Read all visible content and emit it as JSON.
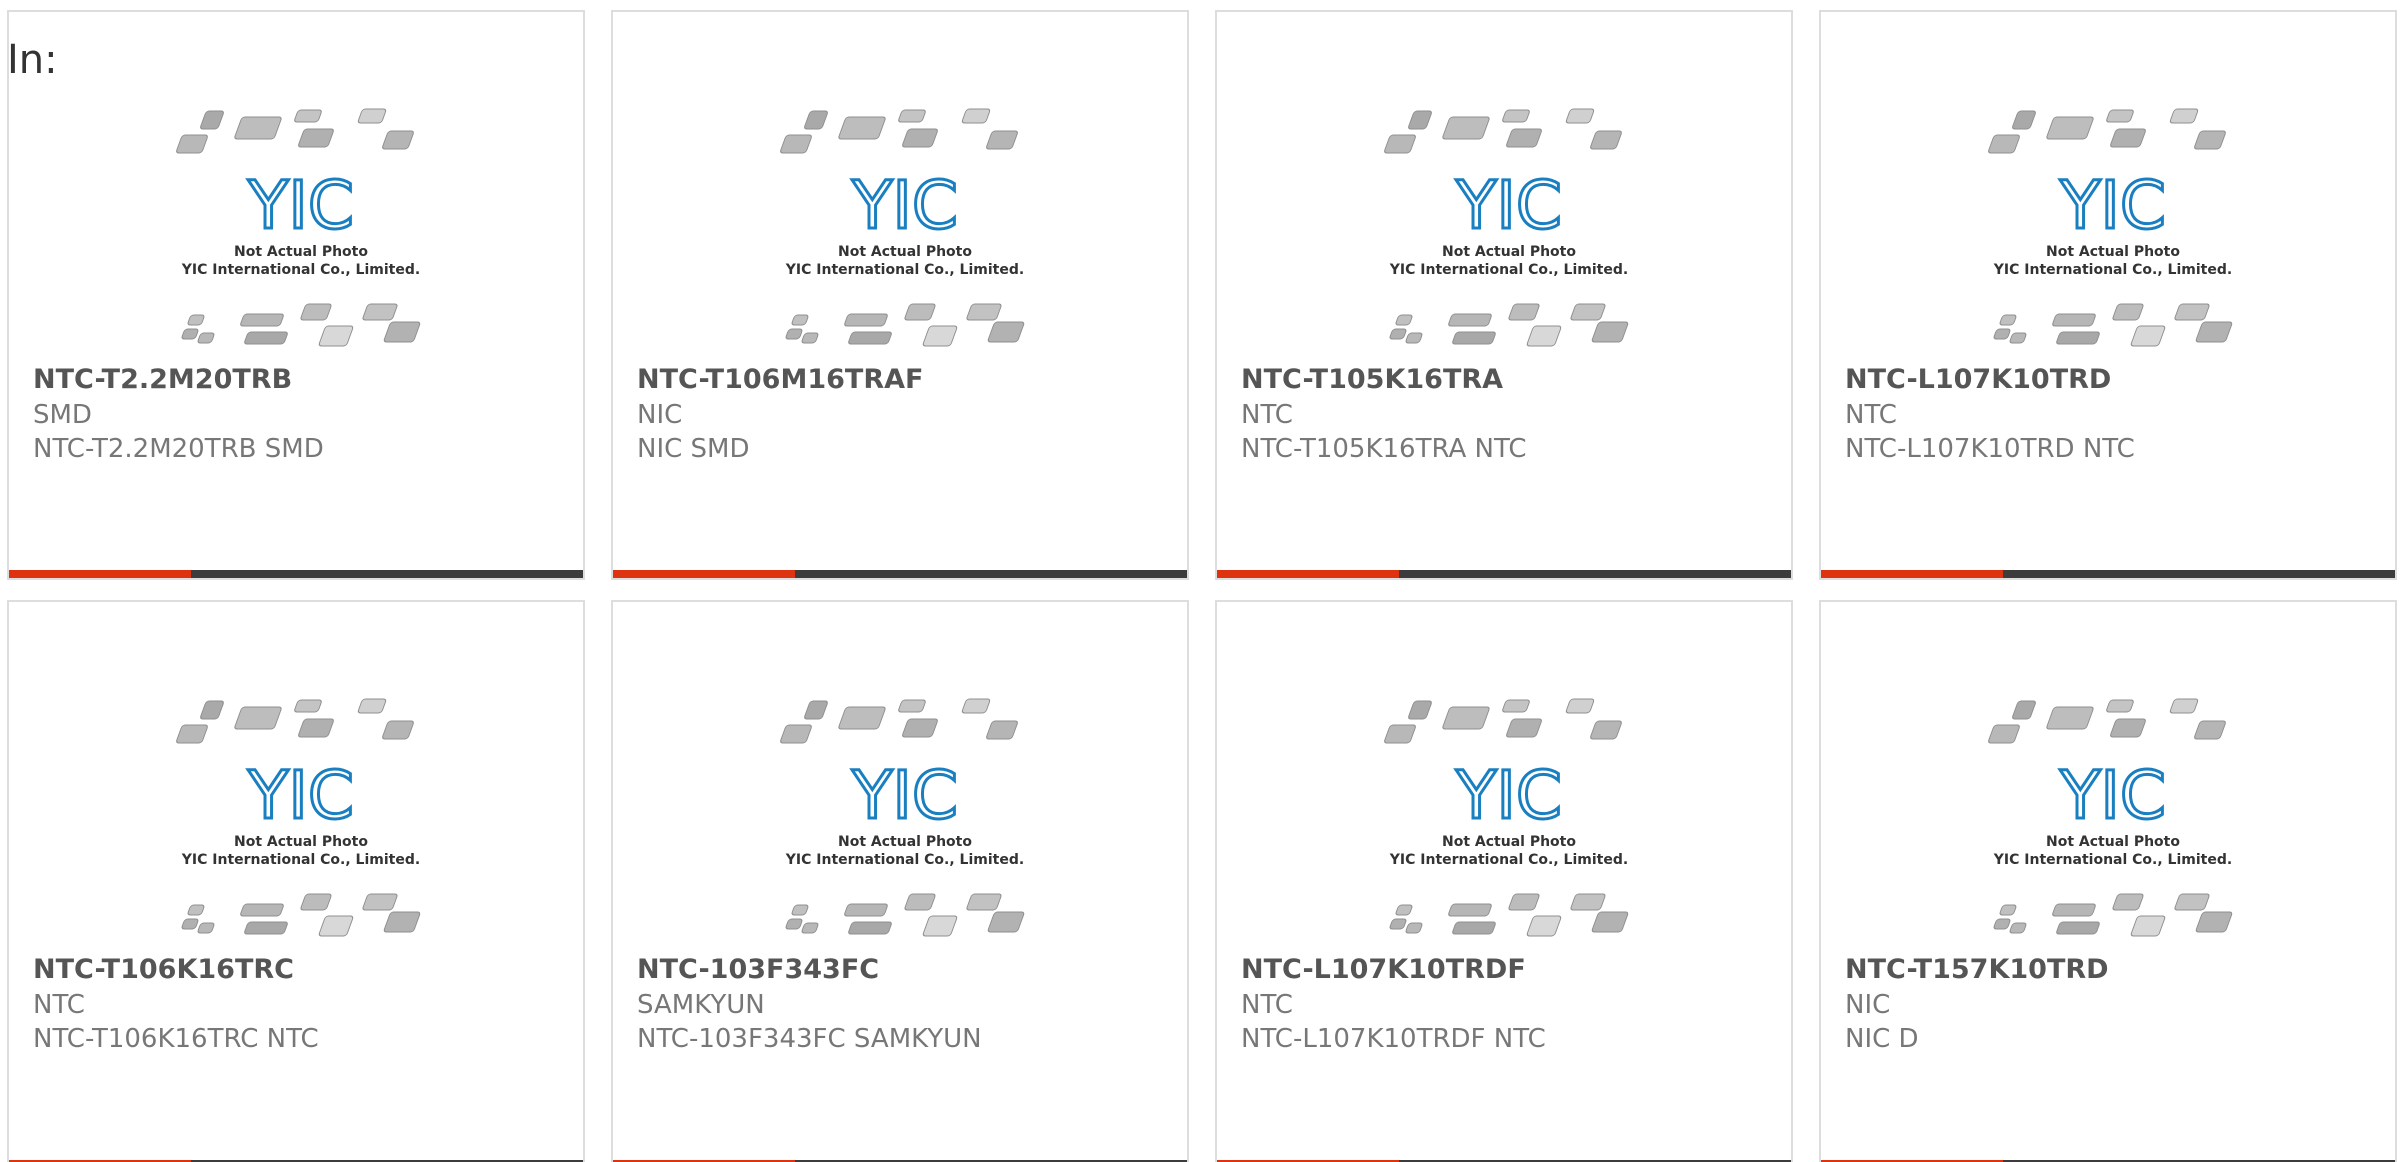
{
  "header": {
    "label": "In:"
  },
  "photo": {
    "brand": "YIC",
    "caption_line1": "Not Actual Photo",
    "caption_line2": "YIC International Co., Limited."
  },
  "colors": {
    "accent": "#dd3311",
    "bar": "#3c3c3c",
    "brand_blue": "#1a7fc1"
  },
  "products": [
    {
      "part_number": "NTC-T2.2M20TRB",
      "manufacturer": "SMD",
      "description": "NTC-T2.2M20TRB SMD"
    },
    {
      "part_number": "NTC-T106M16TRAF",
      "manufacturer": "NIC",
      "description": "NIC SMD"
    },
    {
      "part_number": "NTC-T105K16TRA",
      "manufacturer": "NTC",
      "description": "NTC-T105K16TRA NTC"
    },
    {
      "part_number": "NTC-L107K10TRD",
      "manufacturer": "NTC",
      "description": "NTC-L107K10TRD NTC"
    },
    {
      "part_number": "NTC-T106K16TRC",
      "manufacturer": "NTC",
      "description": "NTC-T106K16TRC NTC"
    },
    {
      "part_number": "NTC-103F343FC",
      "manufacturer": "SAMKYUN",
      "description": "NTC-103F343FC SAMKYUN"
    },
    {
      "part_number": "NTC-L107K10TRDF",
      "manufacturer": "NTC",
      "description": "NTC-L107K10TRDF NTC"
    },
    {
      "part_number": "NTC-T157K10TRD",
      "manufacturer": "NIC",
      "description": "NIC D"
    }
  ]
}
